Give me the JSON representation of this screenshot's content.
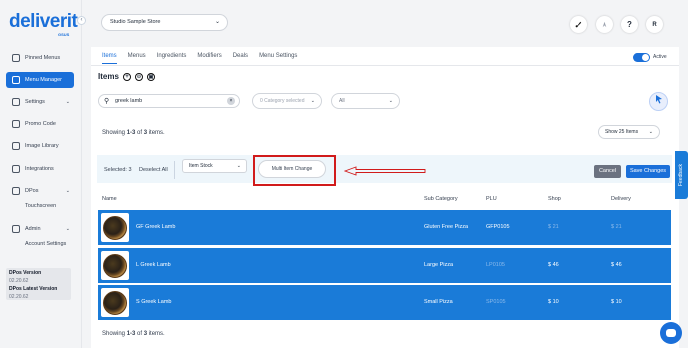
{
  "brand": {
    "name": "deliverit",
    "sub": "GSUS"
  },
  "sidebar": {
    "items": [
      {
        "label": "Pinned Menus",
        "icon": "pin-icon",
        "active": false
      },
      {
        "label": "Menu Manager",
        "icon": "menu-icon",
        "active": true
      },
      {
        "label": "Settings",
        "icon": "gear-icon",
        "active": false
      },
      {
        "label": "Promo Code",
        "icon": "tag-icon",
        "active": false
      },
      {
        "label": "Image Library",
        "icon": "image-icon",
        "active": false
      },
      {
        "label": "Integrations",
        "icon": "plug-icon",
        "active": false
      },
      {
        "label": "DPos",
        "icon": "pos-icon",
        "active": false
      },
      {
        "label": "Admin",
        "icon": "admin-icon",
        "active": false
      }
    ],
    "subitems": {
      "dpos": "Touchscreen",
      "admin": "Account Settings"
    },
    "version": {
      "dpos_label": "DPos Version",
      "dpos_value": "02.20.62",
      "latest_label": "DPos Latest Version",
      "latest_value": "02.20.62"
    }
  },
  "header": {
    "store": "Studio Sample Store",
    "icons": [
      "rocket-icon",
      "launch-icon",
      "help-icon",
      "user-avatar"
    ],
    "help_glyph": "?",
    "avatar_initial": "R"
  },
  "tabs": [
    "Items",
    "Menus",
    "Ingredients",
    "Modifiers",
    "Deals",
    "Menu Settings"
  ],
  "active_tab": "Items",
  "status_toggle": {
    "label": "Active",
    "on": true
  },
  "page_title": "Items",
  "title_buttons": [
    "+",
    "⊙",
    "▣"
  ],
  "search": {
    "value": "greek lamb",
    "clear": "×"
  },
  "category_filter": {
    "placeholder": "0 Category selected"
  },
  "status_filter": {
    "value": "All"
  },
  "showing_top": {
    "pre": "Showing ",
    "range": "1-3",
    "mid": " of ",
    "total": "3",
    "post": " items."
  },
  "page_size": "Show 25 Items",
  "action_bar": {
    "selected": "Selected: 3",
    "deselect": "Deselect All",
    "stock_dropdown": "Item Stock",
    "multi_change": "Multi Item Change",
    "cancel": "Cancel",
    "save": "Save Changes"
  },
  "table": {
    "headers": [
      "Name",
      "Sub Category",
      "PLU",
      "Shop",
      "Delivery"
    ],
    "rows": [
      {
        "name": "GF Greek Lamb",
        "sub_category": "Gluten Free Pizza",
        "plu": "GFP0105",
        "shop": "$ 21",
        "delivery": "$ 21",
        "shop_faded": true,
        "delivery_faded": true,
        "plu_faded": false
      },
      {
        "name": "L Greek Lamb",
        "sub_category": "Large Pizza",
        "plu": "LP0105",
        "shop": "$ 46",
        "delivery": "$ 46",
        "shop_faded": false,
        "delivery_faded": false,
        "plu_faded": true
      },
      {
        "name": "S Greek Lamb",
        "sub_category": "Small Pizza",
        "plu": "SP0105",
        "shop": "$ 10",
        "delivery": "$ 10",
        "shop_faded": false,
        "delivery_faded": false,
        "plu_faded": true
      }
    ]
  },
  "showing_bottom": {
    "pre": "Showing ",
    "range": "1-3",
    "mid": " of ",
    "total": "3",
    "post": " items."
  },
  "feedback_tab": "Feedback",
  "colors": {
    "accent": "#1a6fd9",
    "row": "#1a7bd8",
    "highlight": "#d11b1b"
  }
}
